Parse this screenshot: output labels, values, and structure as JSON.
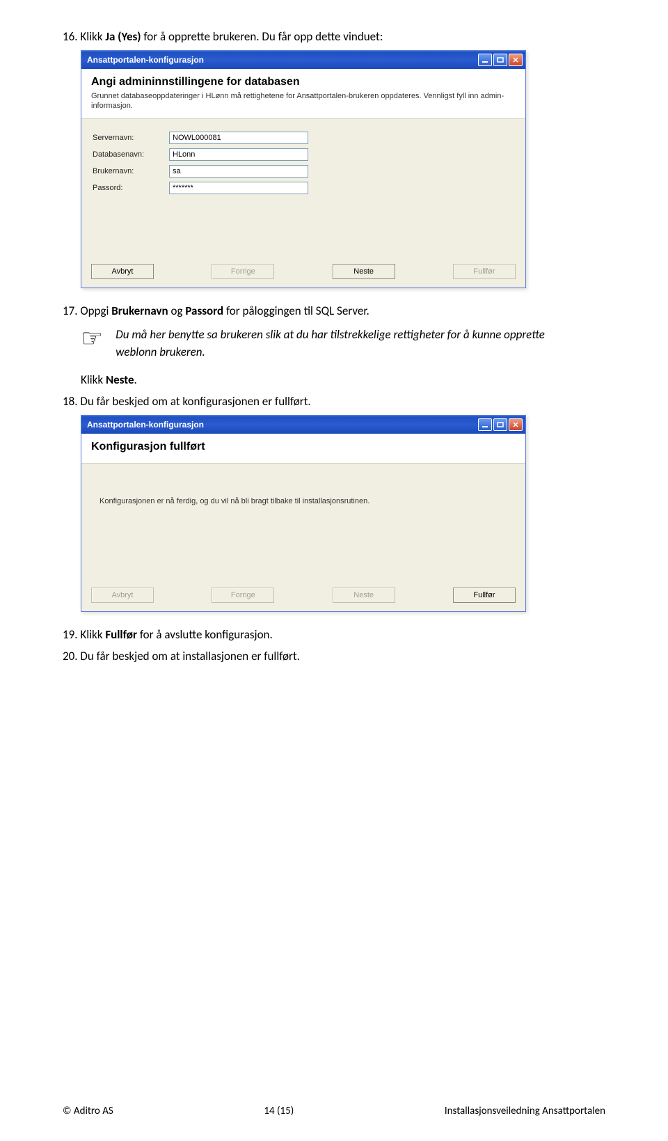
{
  "item16": {
    "num": "16.",
    "pre": " Klikk ",
    "bold": "Ja (Yes)",
    "post": " for å opprette brukeren. Du får opp dette vinduet:"
  },
  "dialog1": {
    "title": "Ansattportalen-konfigurasjon",
    "heading": "Angi admininnstillingene for databasen",
    "subtext": "Grunnet databaseoppdateringer i HLønn må rettighetene for Ansattportalen-brukeren oppdateres. Vennligst fyll inn admin-informasjon.",
    "labels": {
      "server": "Servernavn:",
      "db": "Databasenavn:",
      "user": "Brukernavn:",
      "pass": "Passord:"
    },
    "values": {
      "server": "NOWL000081",
      "db": "HLonn",
      "user": "sa",
      "pass": "*******"
    },
    "buttons": {
      "avbryt": "Avbryt",
      "forrige": "Forrige",
      "neste": "Neste",
      "fullfor": "Fullfør"
    }
  },
  "item17": {
    "num": "17.",
    "pre": " Oppgi ",
    "bold1": "Brukernavn",
    "mid": " og ",
    "bold2": "Passord",
    "post": " for påloggingen til SQL Server."
  },
  "note": "Du må her benytte sa brukeren slik at du har tilstrekkelige rettigheter for å kunne opprette weblonn brukeren.",
  "clickNeste": {
    "pre": "Klikk ",
    "bold": "Neste",
    "post": "."
  },
  "item18": {
    "num": "18.",
    "text": " Du får beskjed om at konfigurasjonen er fullført."
  },
  "dialog2": {
    "title": "Ansattportalen-konfigurasjon",
    "heading": "Konfigurasjon fullført",
    "body": "Konfigurasjonen er nå ferdig, og du vil nå bli bragt tilbake til installasjonsrutinen.",
    "buttons": {
      "avbryt": "Avbryt",
      "forrige": "Forrige",
      "neste": "Neste",
      "fullfor": "Fullfør"
    }
  },
  "item19": {
    "num": "19.",
    "pre": " Klikk ",
    "bold": "Fullfør",
    "post": " for å avslutte konfigurasjon."
  },
  "item20": {
    "num": "20.",
    "text": " Du får beskjed om at installasjonen er fullført."
  },
  "footer": {
    "left": "© Aditro AS",
    "center": "14 (15)",
    "right": "Installasjonsveiledning Ansattportalen"
  }
}
